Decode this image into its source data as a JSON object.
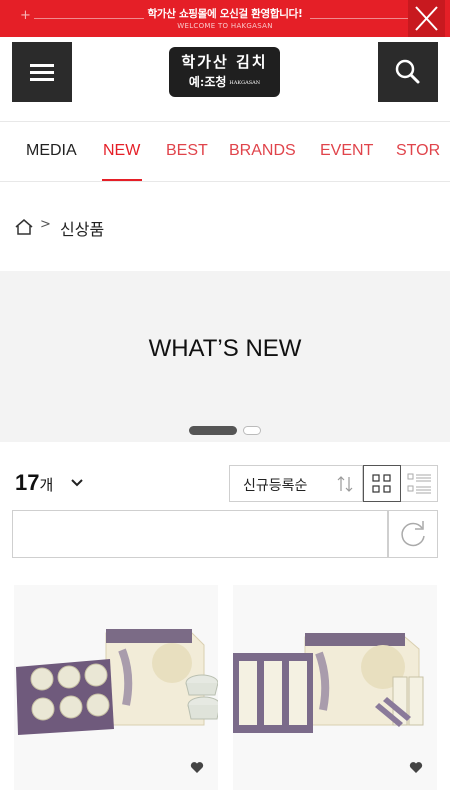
{
  "banner": {
    "message": "학가산 쇼핑몰에 오신걸 환영합니다!",
    "sub": "WELCOME TO HAKGASAN",
    "plus_glyph": "+",
    "close_icon": "close-icon"
  },
  "header": {
    "menu_icon": "hamburger-menu-icon",
    "search_icon": "search-icon",
    "logo_line1": "학가산 김치",
    "logo_line2": "예:조청",
    "logo_small": "HAKGASAN"
  },
  "nav": {
    "items": [
      {
        "label": "MEDIA",
        "color": "#222222"
      },
      {
        "label": "NEW",
        "color": "#e51f27",
        "active": true
      },
      {
        "label": "BEST",
        "color": "#e0444b"
      },
      {
        "label": "BRANDS",
        "color": "#e0444b"
      },
      {
        "label": "EVENT",
        "color": "#e0444b"
      },
      {
        "label": "STOR",
        "color": "#e0444b"
      }
    ]
  },
  "breadcrumb": {
    "home_icon": "home-icon",
    "separator": ">",
    "current": "신상품"
  },
  "hero": {
    "title": "WHAT’S NEW",
    "slides_total": 2,
    "active_slide": 1
  },
  "toolbar": {
    "count": "17",
    "count_unit": "개",
    "sort_label": "신규등록순",
    "grid_view_active": true
  },
  "search": {
    "placeholder": "",
    "value": ""
  },
  "products": [
    {
      "image_icon": "product-image-icon",
      "wishlist_icon": "heart-icon"
    },
    {
      "image_icon": "product-image-icon",
      "wishlist_icon": "heart-icon"
    }
  ],
  "colors": {
    "brand_red": "#e51f27",
    "dark_button": "#2b2b2b"
  }
}
